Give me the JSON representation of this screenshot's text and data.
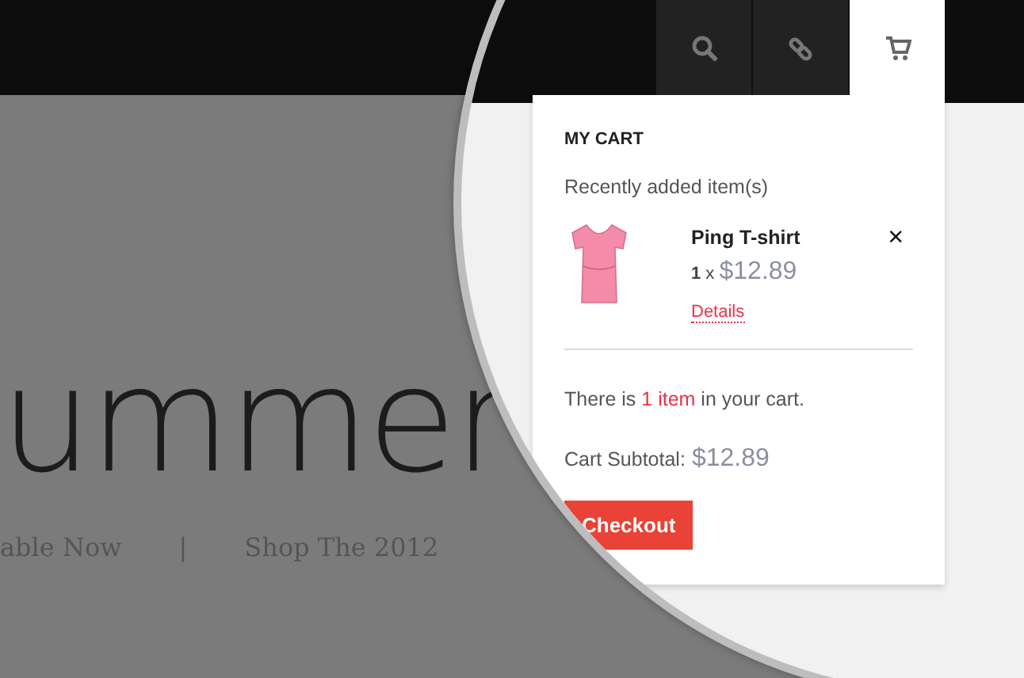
{
  "nav_icons": [
    {
      "kind": "search",
      "selected": false
    },
    {
      "kind": "link",
      "selected": false
    },
    {
      "kind": "cart",
      "selected": true
    }
  ],
  "hero": {
    "title": "ummer",
    "subline": [
      "able Now",
      "|",
      "Shop The 2012"
    ]
  },
  "cart": {
    "title": "MY CART",
    "recent_label": "Recently added item(s)",
    "items": [
      {
        "name": "Ping T-shirt",
        "qty": "1",
        "times": "x",
        "price": "$12.89",
        "details": "Details",
        "remove": "×"
      }
    ],
    "summary": {
      "before": "There is",
      "count": "1 item",
      "after": "in your cart."
    },
    "subtotal_label": "Cart Subtotal:",
    "subtotal": "$12.89",
    "checkout": "Checkout"
  }
}
